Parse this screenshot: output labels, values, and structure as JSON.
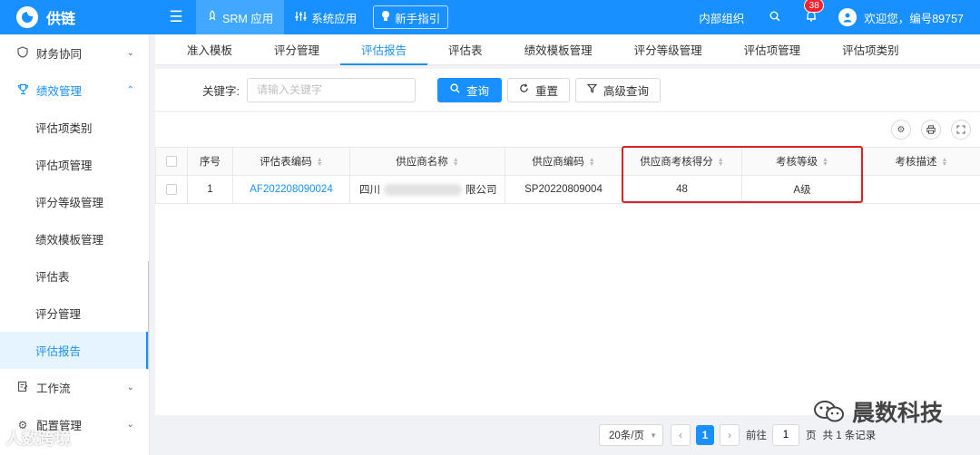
{
  "topbar": {
    "logo_text": "供链",
    "nav": [
      {
        "label": "SRM 应用",
        "icon": "rocket-icon"
      },
      {
        "label": "系统应用",
        "icon": "sliders-icon"
      }
    ],
    "guide_label": "新手指引",
    "org_label": "内部组织",
    "notification_count": "38",
    "welcome": "欢迎您，编号89757"
  },
  "sidebar": {
    "items": [
      {
        "label": "财务协同"
      },
      {
        "label": "绩效管理"
      },
      {
        "label": "评估项类别"
      },
      {
        "label": "评估项管理"
      },
      {
        "label": "评分等级管理"
      },
      {
        "label": "绩效模板管理"
      },
      {
        "label": "评估表"
      },
      {
        "label": "评分管理"
      },
      {
        "label": "评估报告"
      },
      {
        "label": "工作流"
      },
      {
        "label": "配置管理"
      }
    ],
    "watermark": "人数跨境"
  },
  "subtabs": [
    "准入模板",
    "评分管理",
    "评估报告",
    "评估表",
    "绩效模板管理",
    "评分等级管理",
    "评估项管理",
    "评估项类别"
  ],
  "search": {
    "keyword_label": "关键字:",
    "keyword_placeholder": "请输入关键字",
    "query_label": "查询",
    "reset_label": "重置",
    "advanced_label": "高级查询"
  },
  "table": {
    "columns": [
      "序号",
      "评估表编码",
      "供应商名称",
      "供应商编码",
      "供应商考核得分",
      "考核等级",
      "考核描述"
    ],
    "rows": [
      {
        "index": "1",
        "code": "AF202208090024",
        "supplier_prefix": "四川",
        "supplier_suffix": "限公司",
        "supplier_code": "SP20220809004",
        "score": "48",
        "grade": "A级",
        "desc": ""
      }
    ]
  },
  "pagination": {
    "page_size": "20条/页",
    "current_page": "1",
    "goto_label": "前往",
    "goto_value": "1",
    "page_unit": "页",
    "total": "共 1 条记录"
  },
  "watermark_right": "晨数科技"
}
